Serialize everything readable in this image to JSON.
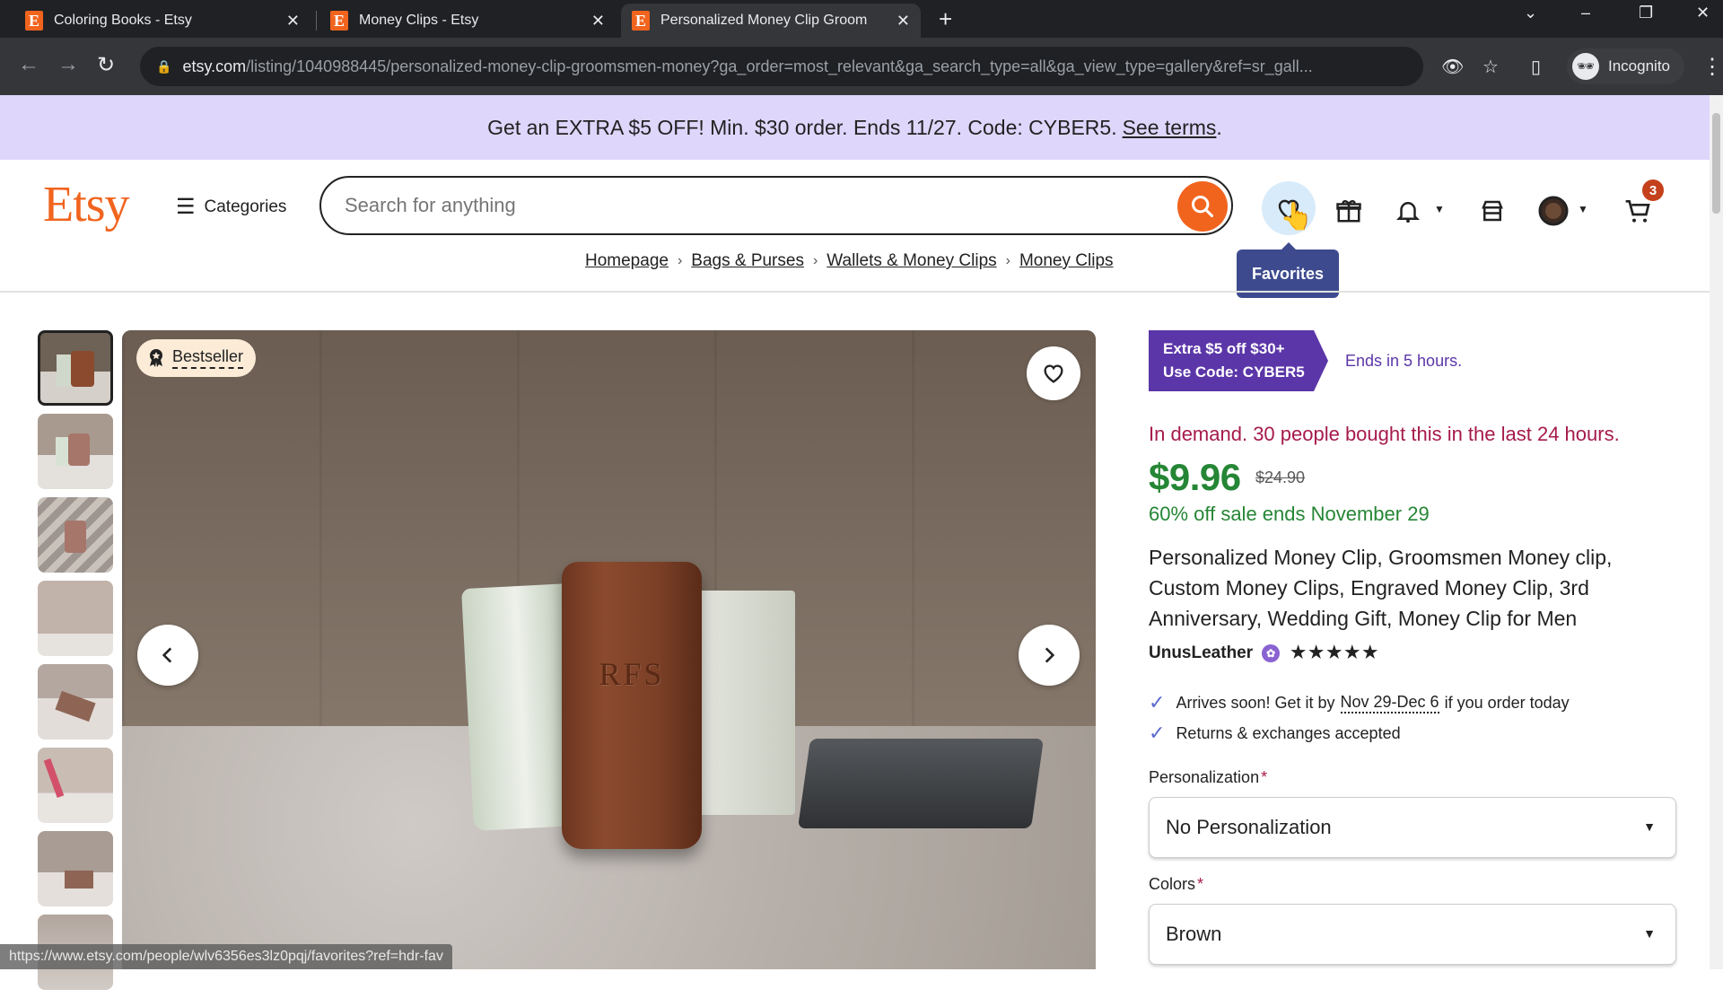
{
  "browser": {
    "tabs": [
      {
        "title": "Coloring Books - Etsy",
        "active": false
      },
      {
        "title": "Money Clips - Etsy",
        "active": false
      },
      {
        "title": "Personalized Money Clip Groom",
        "active": true
      }
    ],
    "favicon_letter": "E",
    "close_glyph": "✕",
    "new_tab_glyph": "+",
    "url_host": "etsy.com",
    "url_path": "/listing/1040988445/personalized-money-clip-groomsmen-money?ga_order=most_relevant&ga_search_type=all&ga_view_type=gallery&ref=sr_gall...",
    "profile_label": "Incognito",
    "status_url": "https://www.etsy.com/people/wlv6356es3lz0pqj/favorites?ref=hdr-fav"
  },
  "banner": {
    "text": "Get an EXTRA $5 OFF! Min. $30 order. Ends 11/27. Code: CYBER5.",
    "link": "See terms",
    "trailing": ".",
    "bg_color": "#dfd6fc"
  },
  "header": {
    "logo": "Etsy",
    "categories_label": "Categories",
    "search_placeholder": "Search for anything",
    "cart_count": "3",
    "tooltip": "Favorites",
    "brand_color": "#f1641e"
  },
  "breadcrumb": [
    "Homepage",
    "Bags & Purses",
    "Wallets & Money Clips",
    "Money Clips"
  ],
  "gallery": {
    "badge": "Bestseller",
    "engraving": "RFS",
    "thumbnail_count": 8,
    "active_thumbnail": 1
  },
  "listing": {
    "promo_line1": "Extra $5 off $30+",
    "promo_line2": "Use Code: CYBER5",
    "promo_ends": "Ends in 5 hours.",
    "demand": "In demand. 30 people bought this in the last 24 hours.",
    "price": "$9.96",
    "original_price": "$24.90",
    "sale_ends": "60% off sale ends November 29",
    "title": "Personalized Money Clip, Groomsmen Money clip, Custom Money Clips, Engraved Money Clip, 3rd Anniversary, Wedding Gift, Money Clip for Men",
    "shop_name": "UnusLeather",
    "rating": 5,
    "stars": "★★★★★",
    "arrives_prefix": "Arrives soon! Get it by",
    "arrives_date": "Nov 29-Dec 6",
    "arrives_suffix": "if you order today",
    "returns": "Returns & exchanges accepted",
    "personalization_label": "Personalization",
    "personalization_value": "No Personalization",
    "colors_label": "Colors",
    "colors_value": "Brown",
    "required_mark": "*",
    "price_color": "#258635",
    "demand_color": "#a61a4c",
    "promo_color": "#5b36a8"
  }
}
